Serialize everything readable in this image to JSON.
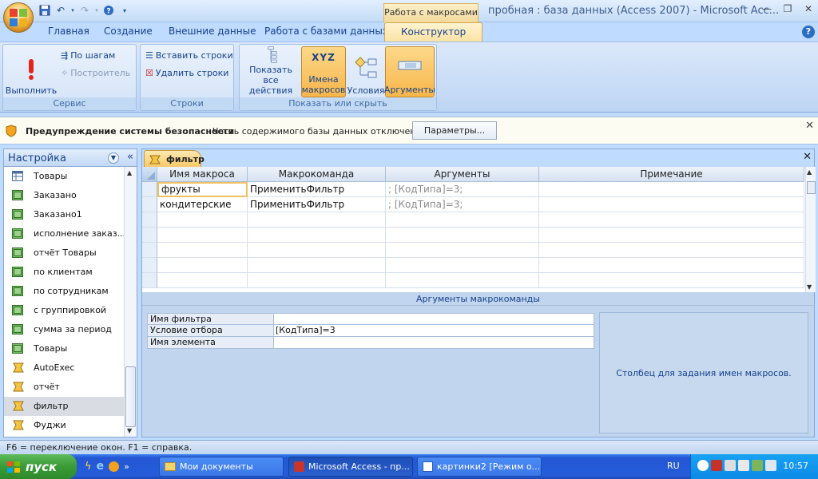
{
  "window": {
    "title": "пробная : база данных (Access 2007) - Microsoft Acc...",
    "context_tab_header": "Работа с макросами"
  },
  "ribbon_tabs": [
    "Главная",
    "Создание",
    "Внешние данные",
    "Работа с базами данных",
    "Конструктор"
  ],
  "ribbon": {
    "service": {
      "label": "Сервис",
      "run": "Выполнить",
      "step": "По шагам",
      "builder": "Построитель"
    },
    "rows": {
      "label": "Строки",
      "insert": "Вставить строки",
      "delete": "Удалить строки"
    },
    "show_hide": {
      "label": "Показать или скрыть",
      "show_all_line1": "Показать",
      "show_all_line2": "все действия",
      "macro_names_line1": "Имена",
      "macro_names_line2": "макросов",
      "macro_names_icon_text": "XYZ",
      "conditions": "Условия",
      "arguments": "Аргументы"
    }
  },
  "security_bar": {
    "title": "Предупреждение системы безопасности",
    "message": "Часть содержимого базы данных отключено",
    "button": "Параметры..."
  },
  "nav": {
    "header": "Настройка",
    "items": [
      {
        "label": "Товары",
        "icon": "table-icon"
      },
      {
        "label": "Заказано",
        "icon": "query-icon"
      },
      {
        "label": "Заказано1",
        "icon": "query-icon"
      },
      {
        "label": "исполнение заказ...",
        "icon": "query-icon"
      },
      {
        "label": "отчёт Товары",
        "icon": "query-icon"
      },
      {
        "label": "по клиентам",
        "icon": "query-icon"
      },
      {
        "label": "по сотрудникам",
        "icon": "query-icon"
      },
      {
        "label": "с группировкой",
        "icon": "query-icon"
      },
      {
        "label": "сумма за период",
        "icon": "query-icon"
      },
      {
        "label": "Товары",
        "icon": "query-icon"
      },
      {
        "label": "AutoExec",
        "icon": "macro-icon"
      },
      {
        "label": "отчёт",
        "icon": "macro-icon"
      },
      {
        "label": "фильтр",
        "icon": "macro-icon"
      },
      {
        "label": "Фуджи",
        "icon": "macro-icon"
      }
    ]
  },
  "document": {
    "tab_label": "фильтр",
    "columns": [
      "Имя макроса",
      "Макрокоманда",
      "Аргументы",
      "Примечание"
    ],
    "rows": [
      {
        "name": "фрукты",
        "action": "ПрименитьФильтр",
        "args": "; [КодТипа]=3;",
        "note": ""
      },
      {
        "name": "кондитерские",
        "action": "ПрименитьФильтр",
        "args": "; [КодТипа]=3;",
        "note": ""
      }
    ],
    "args_title": "Аргументы макрокоманды",
    "args": [
      {
        "key": "Имя фильтра",
        "value": ""
      },
      {
        "key": "Условие отбора",
        "value": "[КодТипа]=3"
      },
      {
        "key": "Имя элемента",
        "value": ""
      }
    ],
    "args_help": "Столбец для задания имен макросов."
  },
  "status_text": "F6 = переключение окон.  F1 = справка.",
  "taskbar": {
    "start": "пуск",
    "tasks": [
      "Мои документы",
      "Microsoft Access - пр...",
      "картинки2 [Режим о..."
    ],
    "lang": "RU",
    "clock": "10:57"
  },
  "colors": {
    "accent": "#f8b64a",
    "ribbon": "#bfdbff",
    "taskbar": "#245cd9"
  }
}
